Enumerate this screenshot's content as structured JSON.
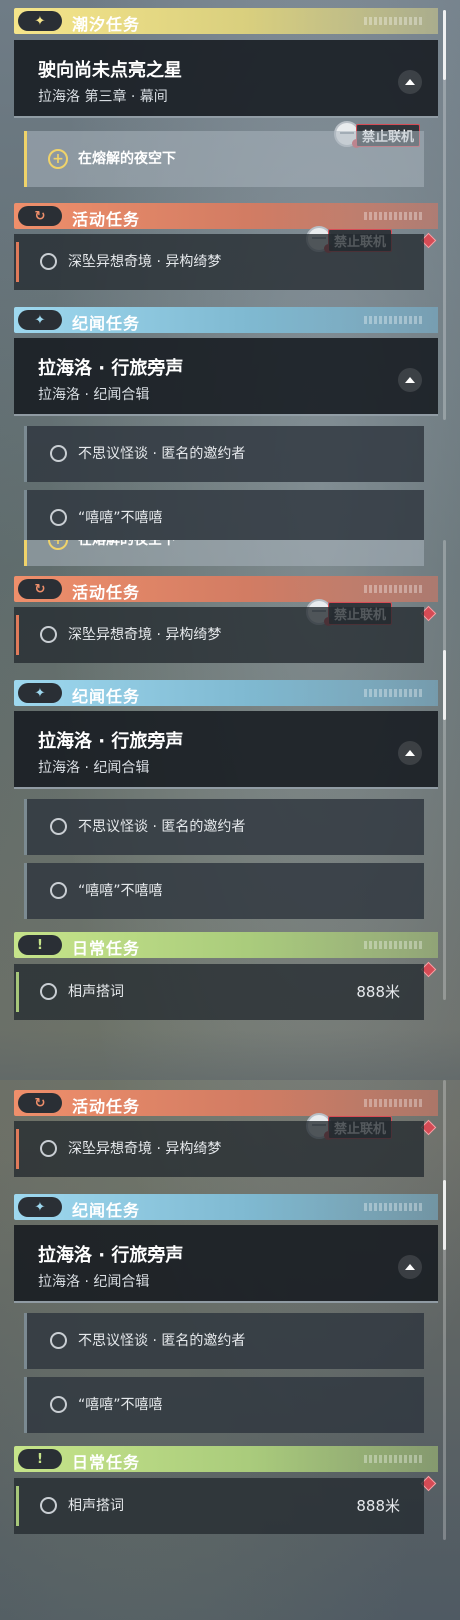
{
  "no_multiplayer_label": "禁止联机",
  "sections": {
    "tide": {
      "header_icon": "✦",
      "header_title": "潮汐任务",
      "card_title": "驶向尚未点亮之星",
      "card_subtitle": "拉海洛 第三章 · 幕间",
      "sub_icon": "+",
      "sub_label": "在熔解的夜空下"
    },
    "event": {
      "header_icon": "↻",
      "header_title": "活动任务",
      "row_label": "深坠异想奇境 · 异构绮梦"
    },
    "legend": {
      "header_icon": "✦",
      "header_title": "纪闻任务",
      "card_title": "拉海洛 · 行旅旁声",
      "card_subtitle": "拉海洛 · 纪闻合辑",
      "sub1_label": "不思议怪谈 · 匿名的邀约者",
      "sub2_label": "“嘻嘻”不嘻嘻"
    },
    "daily": {
      "header_icon": "!",
      "header_title": "日常任务",
      "row_label": "相声搭词",
      "distance": "888米"
    }
  },
  "colors": {
    "tide_yellow": "#f5e58a",
    "event_orange": "#ef8f6b",
    "legend_blue": "#9ed8ef",
    "daily_green": "#c6e48a",
    "alert_red": "#d64b55"
  },
  "icons": {
    "tide": "sparkle-icon",
    "event": "refresh-icon",
    "legend": "sparkle-icon",
    "daily": "exclamation-icon",
    "collapse": "chevron-up-icon",
    "quest": "circle-icon",
    "no_multiplayer": "globe-icon"
  }
}
